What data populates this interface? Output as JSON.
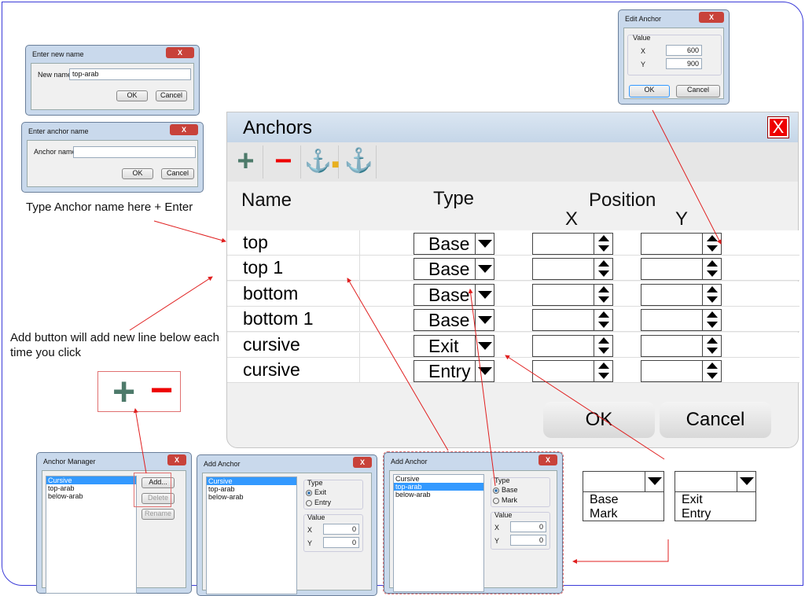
{
  "rename_dialog": {
    "title": "Enter new name",
    "label": "New name",
    "value": "top-arab",
    "ok": "OK",
    "cancel": "Cancel",
    "close": "X"
  },
  "anchor_name_dialog": {
    "title": "Enter anchor name",
    "label": "Anchor name",
    "value": "",
    "ok": "OK",
    "cancel": "Cancel",
    "close": "X"
  },
  "note_type_name": "Type Anchor name here + Enter",
  "note_add_button": "Add button will add new line below each time you click",
  "edit_anchor": {
    "title": "Edit Anchor",
    "group": "Value",
    "x_label": "X",
    "x_value": "600",
    "y_label": "Y",
    "y_value": "900",
    "ok": "OK",
    "cancel": "Cancel",
    "close": "X"
  },
  "anchors": {
    "title": "Anchors",
    "close": "X",
    "toolbar": {
      "add": "+",
      "remove": "−",
      "lock_icon": "anchor-lock-icon",
      "anchor_icon": "anchor-icon"
    },
    "headers": {
      "name": "Name",
      "type": "Type",
      "position": "Position",
      "x": "X",
      "y": "Y"
    },
    "rows": [
      {
        "name": "top",
        "type": "Base",
        "x": "",
        "y": ""
      },
      {
        "name": "top 1",
        "type": "Base",
        "x": "",
        "y": ""
      },
      {
        "name": "bottom",
        "type": "Base",
        "x": "",
        "y": ""
      },
      {
        "name": "bottom 1",
        "type": "Base",
        "x": "",
        "y": ""
      },
      {
        "name": "cursive",
        "type": "Exit",
        "x": "",
        "y": ""
      },
      {
        "name": "cursive",
        "type": "Entry",
        "x": "",
        "y": ""
      }
    ],
    "ok": "OK",
    "cancel": "Cancel"
  },
  "plus_minus": {
    "plus": "+",
    "minus": "−"
  },
  "anchor_manager": {
    "title": "Anchor Manager",
    "close": "X",
    "items": [
      "Cursive",
      "top-arab",
      "below-arab"
    ],
    "selected": 0,
    "add": "Add...",
    "delete": "Delete",
    "rename": "Rename"
  },
  "add_anchor_1": {
    "title": "Add Anchor",
    "close": "X",
    "items": [
      "Cursive",
      "top-arab",
      "below-arab"
    ],
    "selected": 0,
    "type_label": "Type",
    "options": [
      "Exit",
      "Entry"
    ],
    "checked": 0,
    "value_label": "Value",
    "x_label": "X",
    "x_value": "0",
    "y_label": "Y",
    "y_value": "0"
  },
  "add_anchor_2": {
    "title": "Add Anchor",
    "close": "X",
    "items": [
      "Cursive",
      "top-arab",
      "below-arab"
    ],
    "selected": 1,
    "type_label": "Type",
    "options": [
      "Base",
      "Mark"
    ],
    "checked": 0,
    "value_label": "Value",
    "x_label": "X",
    "x_value": "0",
    "y_label": "Y",
    "y_value": "0"
  },
  "dropdown_base_mark": {
    "selected": "",
    "options": [
      "Base",
      "Mark"
    ]
  },
  "dropdown_exit_entry": {
    "selected": "",
    "options": [
      "Exit",
      "Entry"
    ]
  },
  "colors": {
    "arrow": "#e02020",
    "frame": "#3b3bd8",
    "plus": "#4d7a6a",
    "minus": "#e00000"
  }
}
